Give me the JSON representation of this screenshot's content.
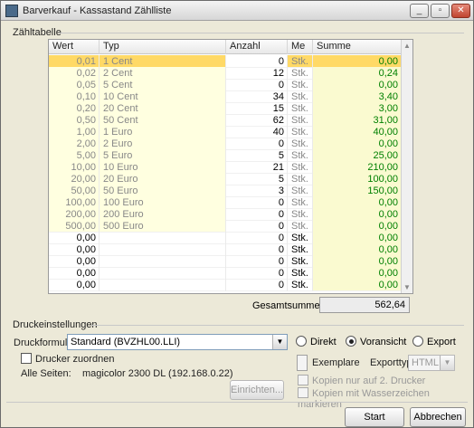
{
  "window": {
    "title": "Barverkauf - Kassastand Zählliste"
  },
  "table_section": "Zähltabelle",
  "columns": [
    "Wert",
    "Typ",
    "Anzahl",
    "Me",
    "Summe"
  ],
  "rows": [
    {
      "wert": "0,01",
      "typ": "1 Cent",
      "anzahl": "0",
      "me": "Stk.",
      "summe": "0,00"
    },
    {
      "wert": "0,02",
      "typ": "2 Cent",
      "anzahl": "12",
      "me": "Stk.",
      "summe": "0,24"
    },
    {
      "wert": "0,05",
      "typ": "5 Cent",
      "anzahl": "0",
      "me": "Stk.",
      "summe": "0,00"
    },
    {
      "wert": "0,10",
      "typ": "10 Cent",
      "anzahl": "34",
      "me": "Stk.",
      "summe": "3,40"
    },
    {
      "wert": "0,20",
      "typ": "20 Cent",
      "anzahl": "15",
      "me": "Stk.",
      "summe": "3,00"
    },
    {
      "wert": "0,50",
      "typ": "50 Cent",
      "anzahl": "62",
      "me": "Stk.",
      "summe": "31,00"
    },
    {
      "wert": "1,00",
      "typ": "1 Euro",
      "anzahl": "40",
      "me": "Stk.",
      "summe": "40,00"
    },
    {
      "wert": "2,00",
      "typ": "2 Euro",
      "anzahl": "0",
      "me": "Stk.",
      "summe": "0,00"
    },
    {
      "wert": "5,00",
      "typ": "5 Euro",
      "anzahl": "5",
      "me": "Stk.",
      "summe": "25,00"
    },
    {
      "wert": "10,00",
      "typ": "10 Euro",
      "anzahl": "21",
      "me": "Stk.",
      "summe": "210,00"
    },
    {
      "wert": "20,00",
      "typ": "20 Euro",
      "anzahl": "5",
      "me": "Stk.",
      "summe": "100,00"
    },
    {
      "wert": "50,00",
      "typ": "50 Euro",
      "anzahl": "3",
      "me": "Stk.",
      "summe": "150,00"
    },
    {
      "wert": "100,00",
      "typ": "100 Euro",
      "anzahl": "0",
      "me": "Stk.",
      "summe": "0,00"
    },
    {
      "wert": "200,00",
      "typ": "200 Euro",
      "anzahl": "0",
      "me": "Stk.",
      "summe": "0,00"
    },
    {
      "wert": "500,00",
      "typ": "500 Euro",
      "anzahl": "0",
      "me": "Stk.",
      "summe": "0,00"
    },
    {
      "wert": "0,00",
      "typ": "",
      "anzahl": "0",
      "me": "Stk.",
      "summe": "0,00"
    },
    {
      "wert": "0,00",
      "typ": "",
      "anzahl": "0",
      "me": "Stk.",
      "summe": "0,00"
    },
    {
      "wert": "0,00",
      "typ": "",
      "anzahl": "0",
      "me": "Stk.",
      "summe": "0,00"
    },
    {
      "wert": "0,00",
      "typ": "",
      "anzahl": "0",
      "me": "Stk.",
      "summe": "0,00"
    },
    {
      "wert": "0,00",
      "typ": "",
      "anzahl": "0",
      "me": "Stk.",
      "summe": "0,00"
    }
  ],
  "total": {
    "label": "Gesamtsumme:",
    "value": "562,64"
  },
  "print": {
    "section": "Druckeinstellungen",
    "form_label": "Druckformular:",
    "form_value": "Standard (BVZHL00.LLI)",
    "radio_direkt": "Direkt",
    "radio_voransicht": "Voransicht",
    "radio_export": "Export",
    "assign_printer": "Drucker zuordnen",
    "all_pages_label": "Alle Seiten:",
    "all_pages_value": "magicolor 2300 DL (192.168.0.22)",
    "setup_button": "Einrichten...",
    "copies_label": "Exemplare",
    "export_type_label": "Exporttyp:",
    "export_type_value": "HTML",
    "copies_second_only": "Kopien nur auf 2. Drucker",
    "copies_watermark": "Kopien mit Wasserzeichen markieren"
  },
  "buttons": {
    "start": "Start",
    "cancel": "Abbrechen"
  },
  "colors": {
    "selected_row": "#ffd966",
    "sum_green": "#008000",
    "light_yellow": "#ffffe0"
  }
}
